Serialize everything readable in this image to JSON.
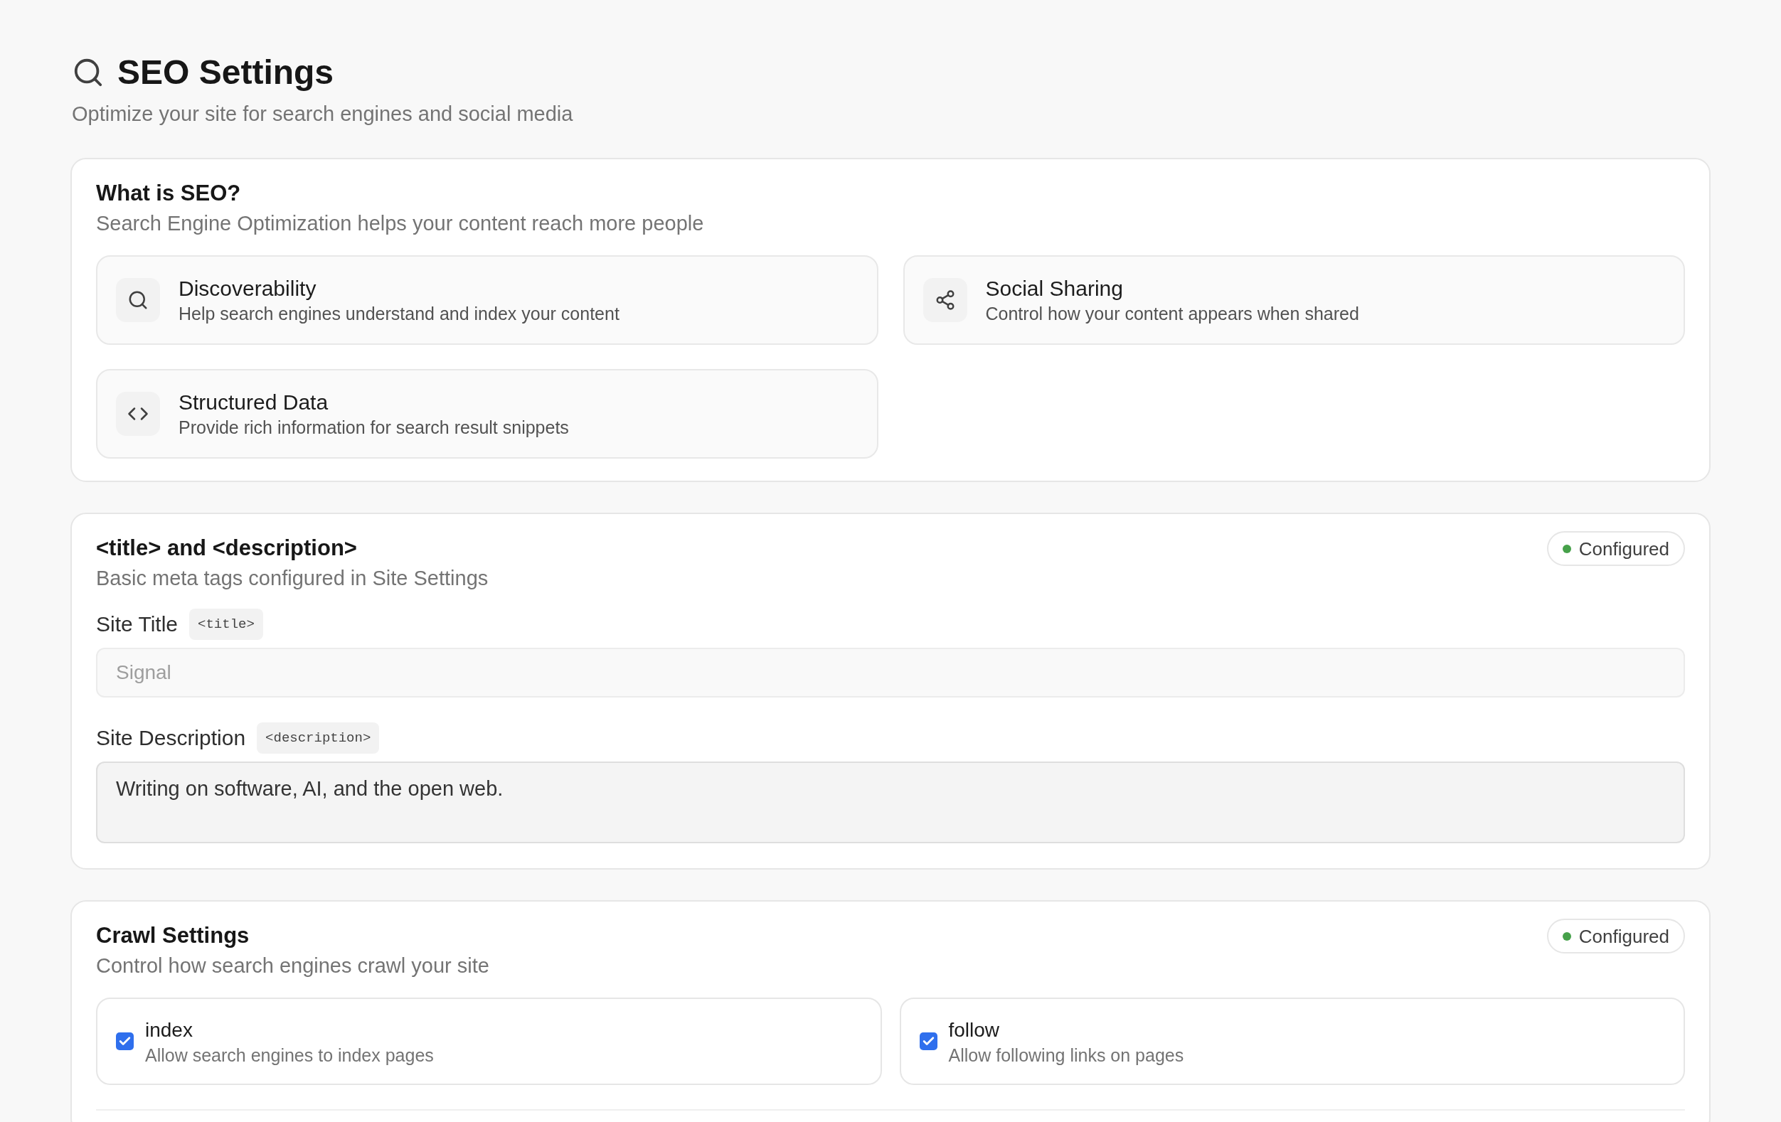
{
  "header": {
    "title": "SEO Settings",
    "subtitle": "Optimize your site for search engines and social media"
  },
  "sections": [
    {
      "kind": "features",
      "title": "What is SEO?",
      "description": "Search Engine Optimization helps your content reach more people",
      "features": [
        {
          "title": "Discoverability",
          "description": "Help search engines understand and index your content"
        },
        {
          "title": "Social Sharing",
          "description": "Control how your content appears when shared"
        },
        {
          "title": "Structured Data",
          "description": "Provide rich information for search result snippets"
        }
      ]
    },
    {
      "kind": "fields",
      "title": "<title> and <description>",
      "description": "Basic meta tags configured in Site Settings",
      "status": {
        "label": "Configured",
        "color": "#46a14a"
      },
      "fields": [
        {
          "kind": "input",
          "label": "Site Title",
          "tag": "<title>",
          "placeholder": "Signal"
        },
        {
          "kind": "textarea",
          "label": "Site Description",
          "tag": "<description>",
          "value": "Writing on software, AI, and the open web."
        }
      ]
    },
    {
      "kind": "toggles",
      "title": "Crawl Settings",
      "description": "Control how search engines crawl your site",
      "status": {
        "label": "Configured",
        "color": "#46a14a"
      },
      "options": [
        {
          "label": "index",
          "description": "Allow search engines to index pages",
          "checked": true
        },
        {
          "label": "follow",
          "description": "Allow following links on pages",
          "checked": true
        }
      ]
    }
  ]
}
